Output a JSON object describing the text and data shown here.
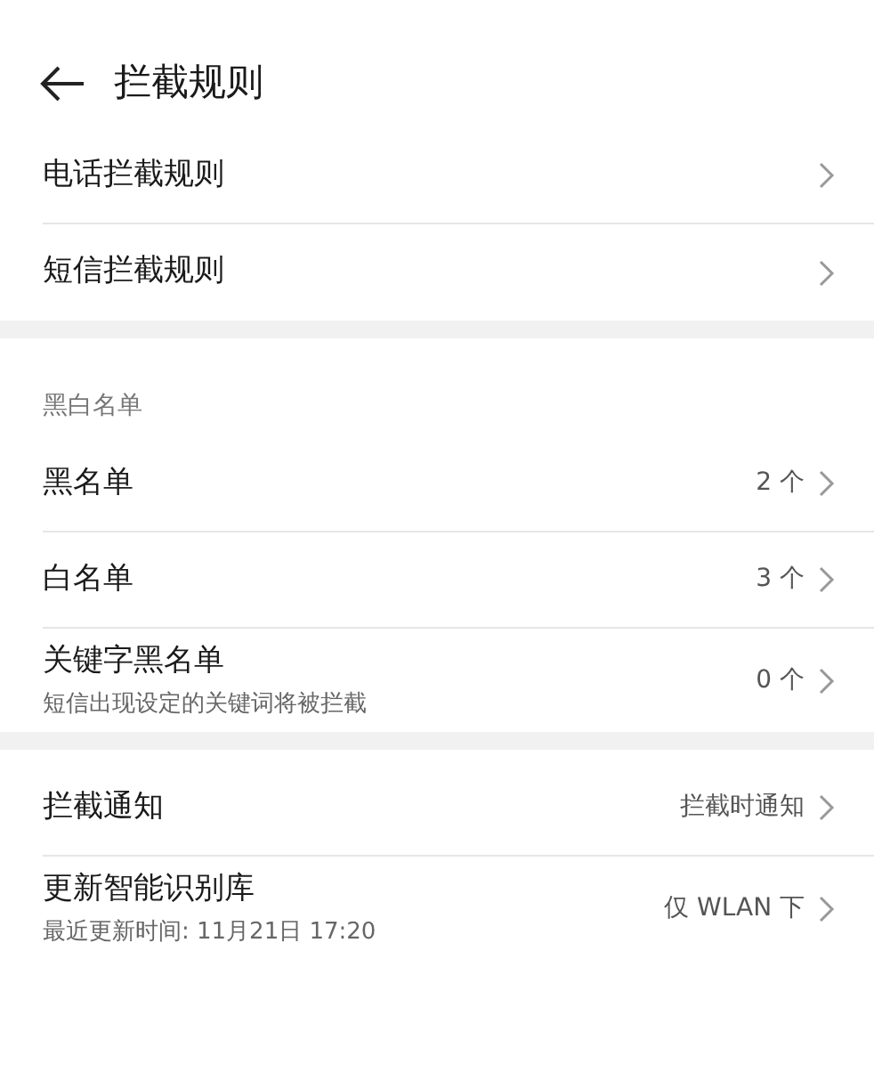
{
  "header": {
    "title": "拦截规则"
  },
  "groups": [
    {
      "items": [
        {
          "title": "电话拦截规则"
        },
        {
          "title": "短信拦截规则"
        }
      ]
    },
    {
      "heading": "黑白名单",
      "items": [
        {
          "title": "黑名单",
          "value": "2 个"
        },
        {
          "title": "白名单",
          "value": "3 个"
        },
        {
          "title": "关键字黑名单",
          "subtitle": "短信出现设定的关键词将被拦截",
          "value": "0 个"
        }
      ]
    },
    {
      "items": [
        {
          "title": "拦截通知",
          "value": "拦截时通知"
        },
        {
          "title": "更新智能识别库",
          "subtitle": "最近更新时间: 11月21日 17:20",
          "value": "仅 WLAN 下"
        }
      ]
    }
  ]
}
